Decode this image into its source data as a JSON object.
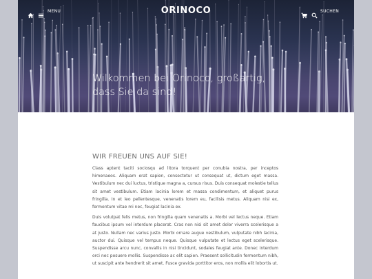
{
  "header": {
    "brand": "ORINOCO",
    "menu_label": "MENU",
    "search_label": "SUCHEN",
    "icons": [
      "home-icon",
      "menu-icon",
      "cart-icon",
      "search-icon"
    ]
  },
  "hero": {
    "title_line1": "Wilkommen bei Orinoco, großartig,",
    "title_line2": "dass Sie da sind!"
  },
  "main": {
    "heading": "WIR FREUEN UNS AUF SIE!",
    "paragraphs": [
      "Class aptent taciti sociosqu ad litora torquent per conubia nostra, per inceptos himenaeos. Aliquam erat sapien, consectetur ut consequat ut, dictum eget massa. Vestibulum nec dui luctus, tristique magna a, cursus risus. Duis consequat molestie tellus sit amet vestibulum. Etiam lacinia lorem et massa condimentum, et aliquet purus fringilla. In et leo pellentesque, venenatis lorem eu, facilisis metus. Aliquam nisi ex, fermentum vitae mi nec, feugiat lacinia ex.",
      "Duis volutpat felis metus, non fringilla quam venenatis a. Morbi vel lectus neque. Etiam faucibus ipsum vel interdum placerat. Cras non nisi sit amet dolor viverra scelerisque a at justo. Nullam nec varius justo. Morbi ornare augue vestibulum, vulputate nibh lacinia, auctor dui. Quisque vel tempus neque. Quisque vulputate et lectus eget scelerisque. Suspendisse arcu nunc, convallis in nisi tincidunt, sodales feugiat ante. Donec interdum orci nec posuere mollis. Suspendisse ac elit sapien. Praesent sollicitudin fermentum nibh, ut suscipit ante hendrerit sit amet. Fusce gravida porttitor eros, non mollis elit lobortis ut."
    ]
  },
  "colors": {
    "page_background": "#c4c6cf",
    "hero_dark": "#1c2336",
    "hero_purple": "#514a78",
    "heading_gray": "#6b6b6b",
    "text_gray": "#4f4f4f"
  }
}
